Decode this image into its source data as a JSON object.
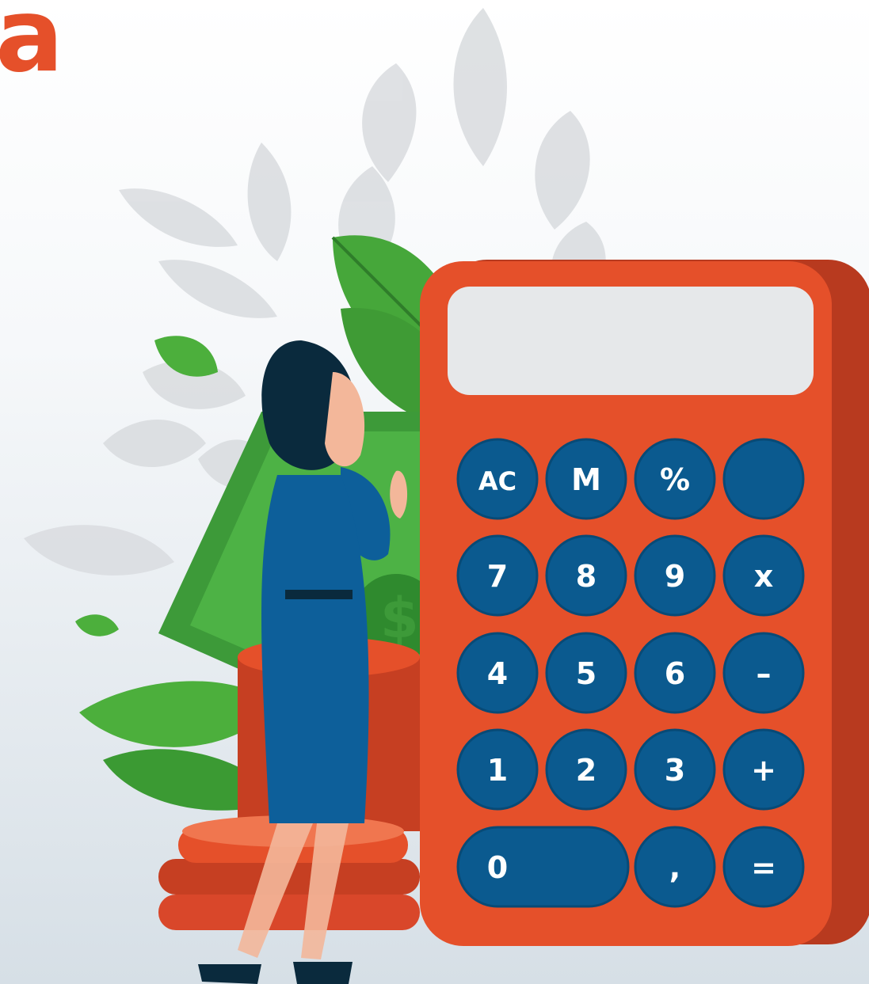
{
  "headline": "a",
  "calculator": {
    "keys": [
      {
        "name": "key-ac",
        "label": "AC"
      },
      {
        "name": "key-m",
        "label": "M"
      },
      {
        "name": "key-percent",
        "label": "%"
      },
      {
        "name": "key-blank",
        "label": ""
      },
      {
        "name": "key-7",
        "label": "7"
      },
      {
        "name": "key-8",
        "label": "8"
      },
      {
        "name": "key-9",
        "label": "9"
      },
      {
        "name": "key-multiply",
        "label": "x"
      },
      {
        "name": "key-4",
        "label": "4"
      },
      {
        "name": "key-5",
        "label": "5"
      },
      {
        "name": "key-6",
        "label": "6"
      },
      {
        "name": "key-minus",
        "label": "–"
      },
      {
        "name": "key-1",
        "label": "1"
      },
      {
        "name": "key-2",
        "label": "2"
      },
      {
        "name": "key-3",
        "label": "3"
      },
      {
        "name": "key-plus",
        "label": "+"
      },
      {
        "name": "key-0",
        "label": "0"
      },
      {
        "name": "key-comma",
        "label": ","
      },
      {
        "name": "key-equals",
        "label": "="
      }
    ]
  },
  "colors": {
    "accent": "#e5502a",
    "calculator_body": "#e5502a",
    "calculator_side": "#b83a1f",
    "display": "#e6e8ea",
    "key": "#0b5a8f",
    "leaf": "#4caf3c",
    "banknote": "#3d9a39",
    "woman_dress": "#0d5f9a",
    "woman_hair": "#0a2a3d"
  },
  "icons": [
    "calculator-icon",
    "banknote-icon",
    "coin-stack-icon",
    "leaf-icon",
    "woman-figure-icon"
  ]
}
